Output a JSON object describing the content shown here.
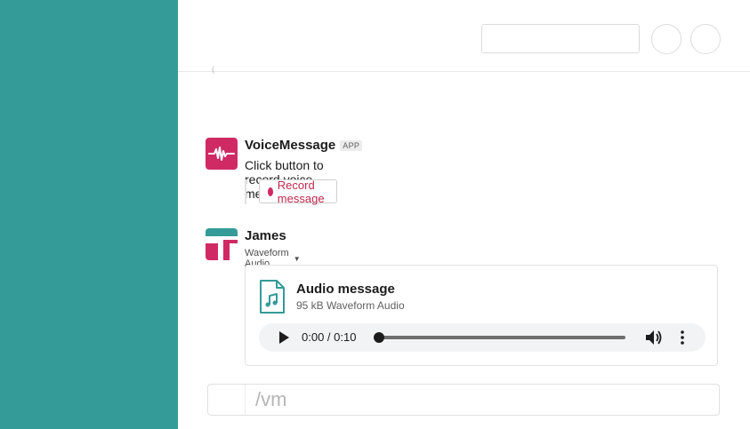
{
  "colors": {
    "sidebar": "#349b99",
    "voicemessage_brand": "#d02a64",
    "record_text": "#c0294e",
    "audio_icon": "#349b99"
  },
  "header": {
    "stray_char": "("
  },
  "voicemessage": {
    "sender": "VoiceMessage",
    "badge": "APP",
    "text": "Click button to record voice message",
    "record_button_label": "Record message",
    "avatar_icon": "waveform-icon"
  },
  "james": {
    "sender": "James",
    "subtitle": "Waveform Audio",
    "attachment": {
      "icon": "audio-file-icon",
      "title": "Audio message",
      "meta": "95 kB Waveform Audio",
      "player": {
        "time": "0:00 / 0:10",
        "progress": 0
      }
    }
  },
  "composer": {
    "value": "/vm"
  }
}
